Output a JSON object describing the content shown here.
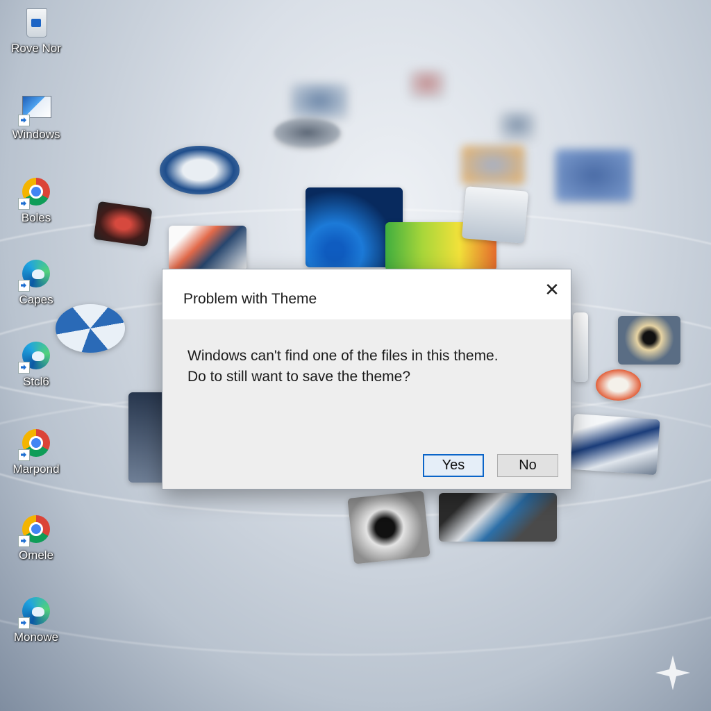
{
  "desktop_icons": [
    {
      "label": "Rove Nor",
      "icon": "recycle-bin-icon"
    },
    {
      "label": "Windows",
      "icon": "monitor-icon"
    },
    {
      "label": "Boles",
      "icon": "chrome-icon"
    },
    {
      "label": "Capes",
      "icon": "edge-icon"
    },
    {
      "label": "Stcl6",
      "icon": "edge-icon"
    },
    {
      "label": "Marpond",
      "icon": "chrome-icon"
    },
    {
      "label": "Omele",
      "icon": "chrome-icon"
    },
    {
      "label": "Monowe",
      "icon": "edge-icon"
    }
  ],
  "dialog": {
    "title": "Problem with Theme",
    "close_glyph": "✕",
    "message_line1": "Windows can't find one of the files in this theme.",
    "message_line2": "Do to still want to save the theme?",
    "yes_label": "Yes",
    "no_label": "No"
  },
  "colors": {
    "accent": "#0a64c8",
    "dialog_background": "#eeeeee",
    "titlebar_background": "#ffffff"
  }
}
